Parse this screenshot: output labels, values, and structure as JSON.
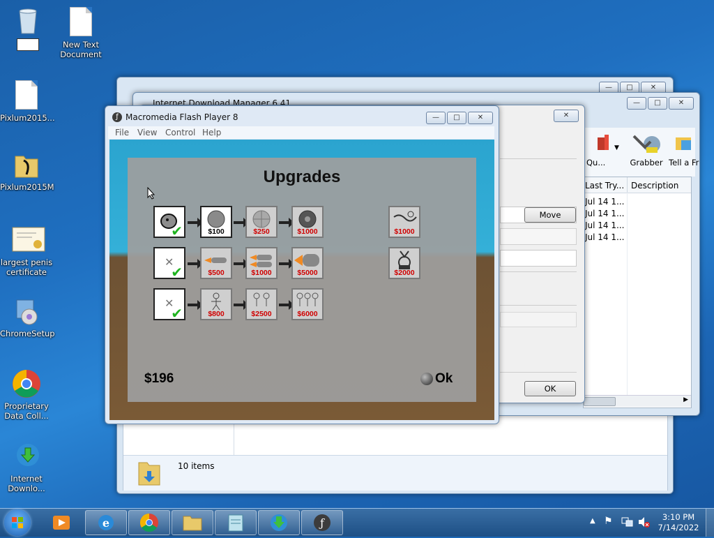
{
  "desktop": {
    "icons": [
      {
        "label": ""
      },
      {
        "label": "New Text Document"
      },
      {
        "label": "Pixlum2015..."
      },
      {
        "label": "Pixlum2015M"
      },
      {
        "label": "largest penis certificate"
      },
      {
        "label": "ChromeSetup"
      },
      {
        "label": "Proprietary Data Coll..."
      },
      {
        "label": "Internet Downlo..."
      }
    ]
  },
  "idm_window": {
    "title": "Internet Download Manager 6.41",
    "toolbar": [
      {
        "label": "Qu..."
      },
      {
        "label": "Grabber"
      },
      {
        "label": "Tell a Fri"
      }
    ],
    "columns": [
      "Last Try...",
      "Description"
    ],
    "rows": [
      "Jul 14 1...",
      "Jul 14 1...",
      "Jul 14 1...",
      "Jul 14 1..."
    ]
  },
  "dialog": {
    "move_label": "Move",
    "ok_label": "OK"
  },
  "explorer": {
    "status": "10 items"
  },
  "flash": {
    "title": "Macromedia Flash Player 8",
    "menu": [
      "File",
      "View",
      "Control",
      "Help"
    ],
    "game": {
      "heading": "Upgrades",
      "money": "$196",
      "ok_label": "Ok",
      "rows": [
        {
          "prices": [
            "$100",
            "$250",
            "$1000"
          ]
        },
        {
          "prices": [
            "$500",
            "$1000",
            "$5000"
          ]
        },
        {
          "prices": [
            "$800",
            "$2500",
            "$6000"
          ]
        }
      ],
      "extras": [
        "$1000",
        "$2000"
      ]
    }
  },
  "taskbar": {
    "time": "3:10 PM",
    "date": "7/14/2022"
  }
}
